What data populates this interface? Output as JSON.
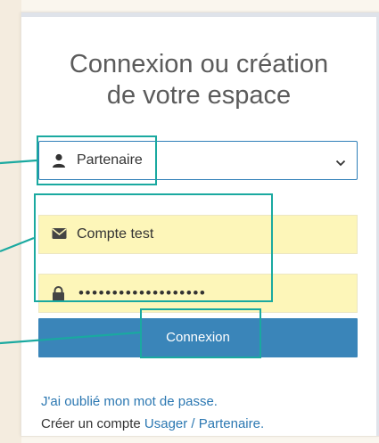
{
  "title": "Connexion ou création\nde votre espace",
  "account_type": {
    "selected": "Partenaire"
  },
  "login": {
    "value": "Compte test"
  },
  "password": {
    "masked_value": "•••••••••••••••••••"
  },
  "submit_label": "Connexion",
  "forgot_password_label": "J'ai oublié mon mot de passe.",
  "create_account": {
    "prefix": "Créer un compte ",
    "link_label": "Usager / Partenaire."
  },
  "colors": {
    "accent": "#3a85b9",
    "link": "#2c78b2",
    "highlight": "#1aa9a0",
    "autofill": "#fdf6b9"
  },
  "icons": {
    "select": "user-icon",
    "login": "envelope-icon",
    "password": "lock-icon",
    "dropdown": "chevron-down-icon"
  }
}
